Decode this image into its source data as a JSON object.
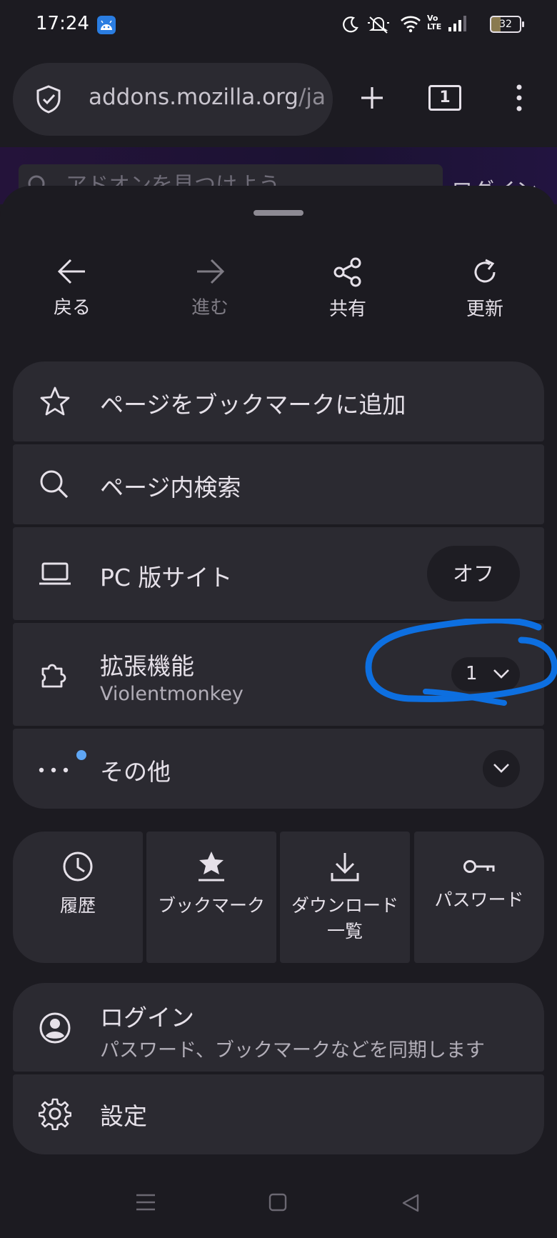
{
  "status_bar": {
    "time": "17:24",
    "battery": "32",
    "icons": [
      "android-icon",
      "moon-icon",
      "mute-icon",
      "wifi-icon",
      "volte-icon",
      "signal-icon",
      "battery-icon"
    ],
    "volte_label": "Vo LTE"
  },
  "browser": {
    "url_host": "addons.mozilla.org",
    "url_path": "/ja",
    "tab_count": "1",
    "page_search_placeholder": "アドオンを見つけよう",
    "page_login": "ログイン"
  },
  "nav_actions": [
    {
      "label": "戻る",
      "icon": "back-arrow-icon",
      "enabled": true
    },
    {
      "label": "進む",
      "icon": "forward-arrow-icon",
      "enabled": false
    },
    {
      "label": "共有",
      "icon": "share-icon",
      "enabled": true
    },
    {
      "label": "更新",
      "icon": "refresh-icon",
      "enabled": true
    }
  ],
  "menu": {
    "bookmark_add": "ページをブックマークに追加",
    "find_in_page": "ページ内検索",
    "desktop_site": {
      "label": "PC 版サイト",
      "state": "オフ"
    },
    "extensions": {
      "label": "拡張機能",
      "sublabel": "Violentmonkey",
      "count": "1"
    },
    "more": {
      "label": "その他"
    }
  },
  "quick_tiles": [
    {
      "label": "履歴",
      "icon": "history-icon"
    },
    {
      "label": "ブックマーク",
      "icon": "bookmark-star-icon"
    },
    {
      "label": "ダウンロード\n一覧",
      "line1": "ダウンロード",
      "line2": "一覧",
      "icon": "download-icon"
    },
    {
      "label": "パスワード",
      "icon": "key-icon"
    }
  ],
  "account": {
    "label": "ログイン",
    "sublabel": "パスワード、ブックマークなどを同期します"
  },
  "settings": {
    "label": "設定"
  },
  "colors": {
    "background": "#1c1b21",
    "card": "#2b2a31",
    "annotation": "#0d6fe0",
    "notification_dot": "#5fa6f4"
  }
}
